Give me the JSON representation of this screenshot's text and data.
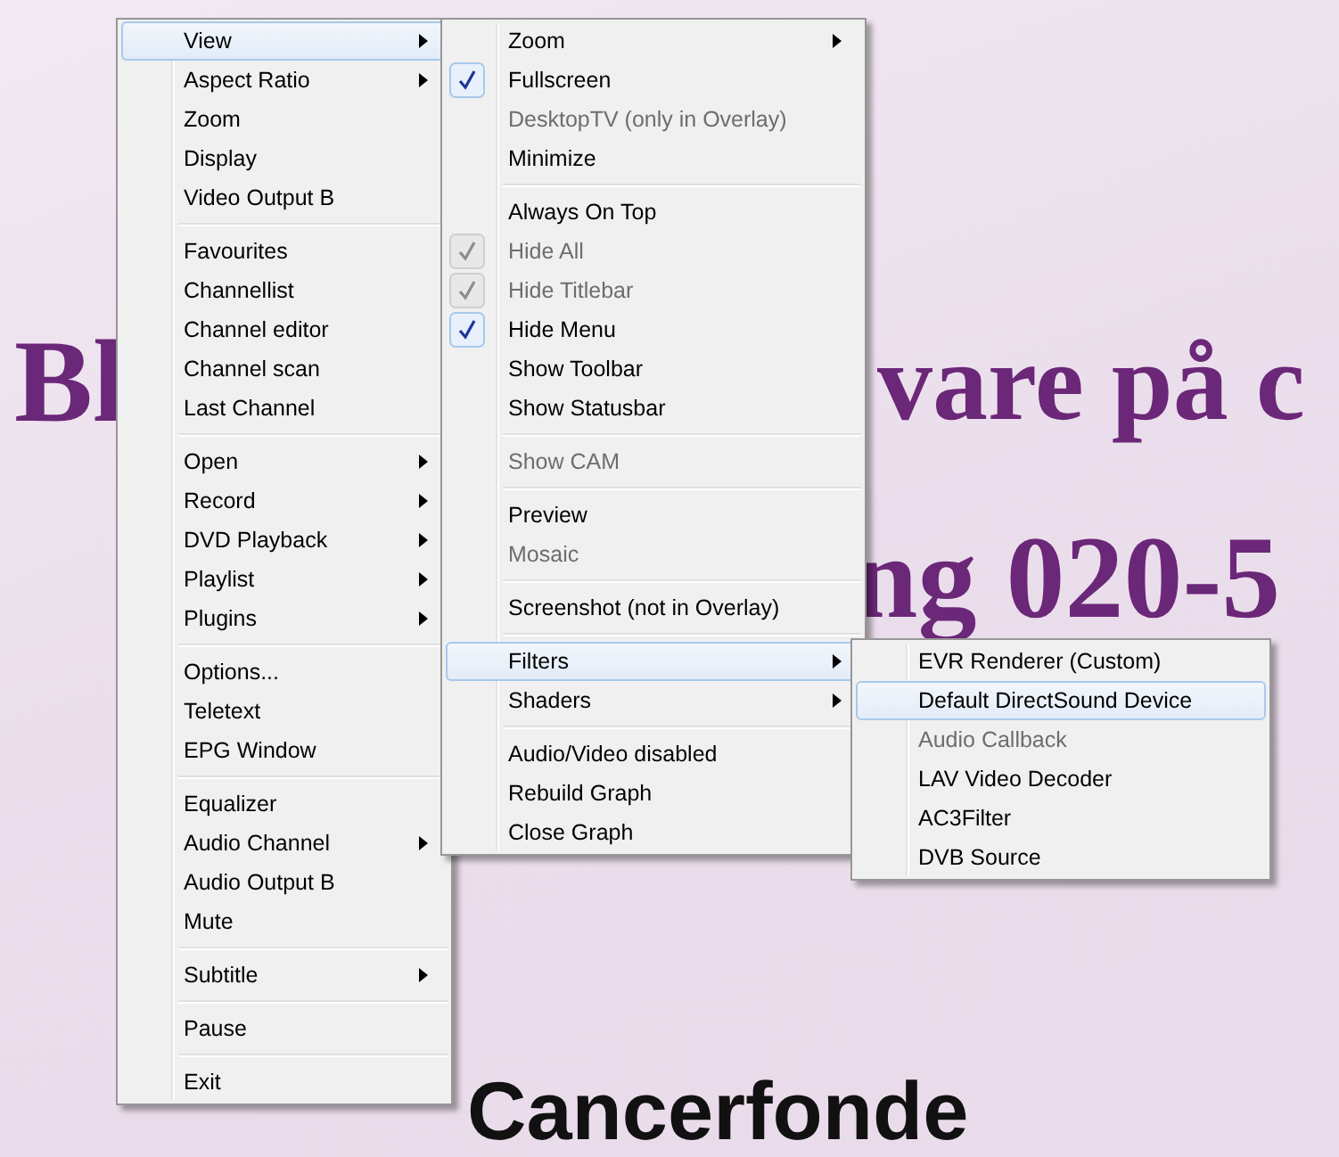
{
  "background": {
    "texts": [
      {
        "text": "Bl",
        "kind": "heading"
      },
      {
        "text": "vare på c",
        "kind": "heading"
      },
      {
        "text": "ng 020-5",
        "kind": "heading"
      },
      {
        "text": "Cancerfonde",
        "kind": "footer"
      }
    ]
  },
  "menus": [
    {
      "items": [
        {
          "kind": "item",
          "label": "View",
          "submenu": true,
          "selected": true
        },
        {
          "kind": "item",
          "label": "Aspect Ratio",
          "submenu": true,
          "selected": false
        },
        {
          "kind": "item",
          "label": "Zoom",
          "submenu": false,
          "selected": false
        },
        {
          "kind": "item",
          "label": "Display",
          "submenu": false,
          "selected": false
        },
        {
          "kind": "item",
          "label": "Video Output B",
          "submenu": false,
          "selected": false
        },
        {
          "kind": "separator"
        },
        {
          "kind": "item",
          "label": "Favourites",
          "submenu": false,
          "selected": false
        },
        {
          "kind": "item",
          "label": "Channellist",
          "submenu": false,
          "selected": false
        },
        {
          "kind": "item",
          "label": "Channel editor",
          "submenu": false,
          "selected": false
        },
        {
          "kind": "item",
          "label": "Channel scan",
          "submenu": false,
          "selected": false
        },
        {
          "kind": "item",
          "label": "Last Channel",
          "submenu": false,
          "selected": false
        },
        {
          "kind": "separator"
        },
        {
          "kind": "item",
          "label": "Open",
          "submenu": true,
          "selected": false
        },
        {
          "kind": "item",
          "label": "Record",
          "submenu": true,
          "selected": false
        },
        {
          "kind": "item",
          "label": "DVD Playback",
          "submenu": true,
          "selected": false
        },
        {
          "kind": "item",
          "label": "Playlist",
          "submenu": true,
          "selected": false
        },
        {
          "kind": "item",
          "label": "Plugins",
          "submenu": true,
          "selected": false
        },
        {
          "kind": "separator"
        },
        {
          "kind": "item",
          "label": "Options...",
          "submenu": false,
          "selected": false
        },
        {
          "kind": "item",
          "label": "Teletext",
          "submenu": false,
          "selected": false
        },
        {
          "kind": "item",
          "label": "EPG Window",
          "submenu": false,
          "selected": false
        },
        {
          "kind": "separator"
        },
        {
          "kind": "item",
          "label": "Equalizer",
          "submenu": false,
          "selected": false
        },
        {
          "kind": "item",
          "label": "Audio Channel",
          "submenu": true,
          "selected": false
        },
        {
          "kind": "item",
          "label": "Audio Output B",
          "submenu": false,
          "selected": false
        },
        {
          "kind": "item",
          "label": "Mute",
          "submenu": false,
          "selected": false
        },
        {
          "kind": "separator"
        },
        {
          "kind": "item",
          "label": "Subtitle",
          "submenu": true,
          "selected": false
        },
        {
          "kind": "separator"
        },
        {
          "kind": "item",
          "label": "Pause",
          "submenu": false,
          "selected": false
        },
        {
          "kind": "separator"
        },
        {
          "kind": "item",
          "label": "Exit",
          "submenu": false,
          "selected": false
        }
      ]
    },
    {
      "items": [
        {
          "kind": "item",
          "label": "Zoom",
          "submenu": true,
          "selected": false,
          "checked": false,
          "disabled": false
        },
        {
          "kind": "item",
          "label": "Fullscreen",
          "submenu": false,
          "selected": false,
          "checked": true,
          "disabled": false
        },
        {
          "kind": "item",
          "label": "DesktopTV (only in Overlay)",
          "submenu": false,
          "selected": false,
          "checked": false,
          "disabled": true
        },
        {
          "kind": "item",
          "label": "Minimize",
          "submenu": false,
          "selected": false,
          "checked": false,
          "disabled": false
        },
        {
          "kind": "separator"
        },
        {
          "kind": "item",
          "label": "Always On Top",
          "submenu": false,
          "selected": false,
          "checked": false,
          "disabled": false
        },
        {
          "kind": "item",
          "label": "Hide All",
          "submenu": false,
          "selected": false,
          "checked": true,
          "disabled": true
        },
        {
          "kind": "item",
          "label": "Hide Titlebar",
          "submenu": false,
          "selected": false,
          "checked": true,
          "disabled": true
        },
        {
          "kind": "item",
          "label": "Hide Menu",
          "submenu": false,
          "selected": false,
          "checked": true,
          "disabled": false
        },
        {
          "kind": "item",
          "label": "Show Toolbar",
          "submenu": false,
          "selected": false,
          "checked": false,
          "disabled": false
        },
        {
          "kind": "item",
          "label": "Show Statusbar",
          "submenu": false,
          "selected": false,
          "checked": false,
          "disabled": false
        },
        {
          "kind": "separator"
        },
        {
          "kind": "item",
          "label": "Show CAM",
          "submenu": false,
          "selected": false,
          "checked": false,
          "disabled": true
        },
        {
          "kind": "separator"
        },
        {
          "kind": "item",
          "label": "Preview",
          "submenu": false,
          "selected": false,
          "checked": false,
          "disabled": false
        },
        {
          "kind": "item",
          "label": "Mosaic",
          "submenu": false,
          "selected": false,
          "checked": false,
          "disabled": true
        },
        {
          "kind": "separator"
        },
        {
          "kind": "item",
          "label": "Screenshot (not in Overlay)",
          "submenu": false,
          "selected": false,
          "checked": false,
          "disabled": false
        },
        {
          "kind": "separator"
        },
        {
          "kind": "item",
          "label": "Filters",
          "submenu": true,
          "selected": true,
          "checked": false,
          "disabled": false
        },
        {
          "kind": "item",
          "label": "Shaders",
          "submenu": true,
          "selected": false,
          "checked": false,
          "disabled": false
        },
        {
          "kind": "separator"
        },
        {
          "kind": "item",
          "label": "Audio/Video disabled",
          "submenu": false,
          "selected": false,
          "checked": false,
          "disabled": false
        },
        {
          "kind": "item",
          "label": "Rebuild Graph",
          "submenu": false,
          "selected": false,
          "checked": false,
          "disabled": false
        },
        {
          "kind": "item",
          "label": "Close Graph",
          "submenu": false,
          "selected": false,
          "checked": false,
          "disabled": false
        }
      ]
    },
    {
      "items": [
        {
          "kind": "item",
          "label": "EVR Renderer (Custom)",
          "selected": false,
          "disabled": false
        },
        {
          "kind": "item",
          "label": "Default DirectSound Device",
          "selected": true,
          "disabled": false
        },
        {
          "kind": "item",
          "label": "Audio Callback",
          "selected": false,
          "disabled": true
        },
        {
          "kind": "item",
          "label": "LAV Video Decoder",
          "selected": false,
          "disabled": false
        },
        {
          "kind": "item",
          "label": "AC3Filter",
          "selected": false,
          "disabled": false
        },
        {
          "kind": "item",
          "label": "DVB Source",
          "selected": false,
          "disabled": false
        }
      ]
    }
  ]
}
